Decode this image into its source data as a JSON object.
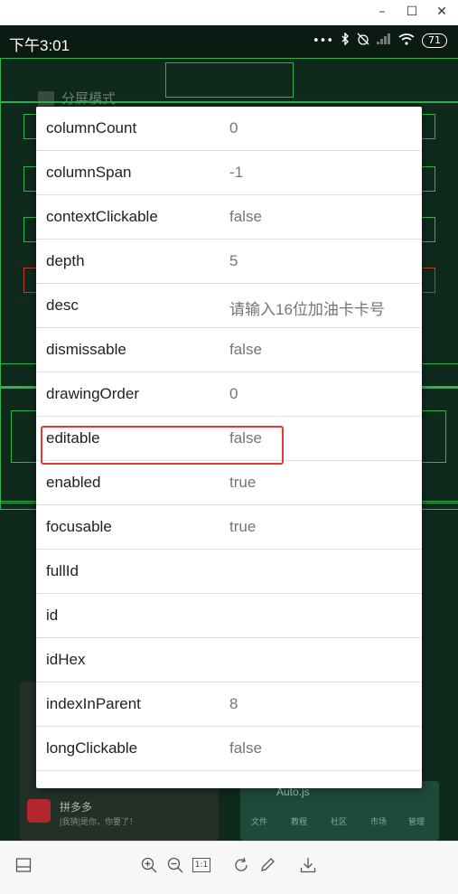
{
  "window": {
    "controls": {
      "minimize": "–",
      "maximize": "☐",
      "close": "✕"
    }
  },
  "statusbar": {
    "time": "下午3:01",
    "dots": "•••",
    "battery": "71"
  },
  "background": {
    "split_mode_label": "分屏模式",
    "app_name": "拼多多",
    "app_desc": "[我猜]是你，你要了！",
    "autojs_title": "Auto.js",
    "autojs_tabs": [
      "文件",
      "教程",
      "社区",
      "市场",
      "管理"
    ]
  },
  "properties": [
    {
      "key": "columnCount",
      "value": "0"
    },
    {
      "key": "columnSpan",
      "value": "-1"
    },
    {
      "key": "contextClickable",
      "value": "false"
    },
    {
      "key": "depth",
      "value": "5"
    },
    {
      "key": "desc",
      "value": "请输入16位加油卡卡号"
    },
    {
      "key": "dismissable",
      "value": "false"
    },
    {
      "key": "drawingOrder",
      "value": "0"
    },
    {
      "key": "editable",
      "value": "false"
    },
    {
      "key": "enabled",
      "value": "true"
    },
    {
      "key": "focusable",
      "value": "true"
    },
    {
      "key": "fullId",
      "value": ""
    },
    {
      "key": "id",
      "value": ""
    },
    {
      "key": "idHex",
      "value": ""
    },
    {
      "key": "indexInParent",
      "value": "8"
    },
    {
      "key": "longClickable",
      "value": "false"
    }
  ],
  "highlighted_property": "editable",
  "toolbar": {
    "items": [
      "layout-icon",
      "zoom-in-icon",
      "zoom-out-icon",
      "actual-size-icon",
      "rotate-icon",
      "edit-icon",
      "download-icon"
    ],
    "actual_size_label": "1:1"
  },
  "colors": {
    "highlight_border": "#e53935",
    "layout_box": "#2fb34a",
    "dialog_bg": "#ffffff"
  }
}
